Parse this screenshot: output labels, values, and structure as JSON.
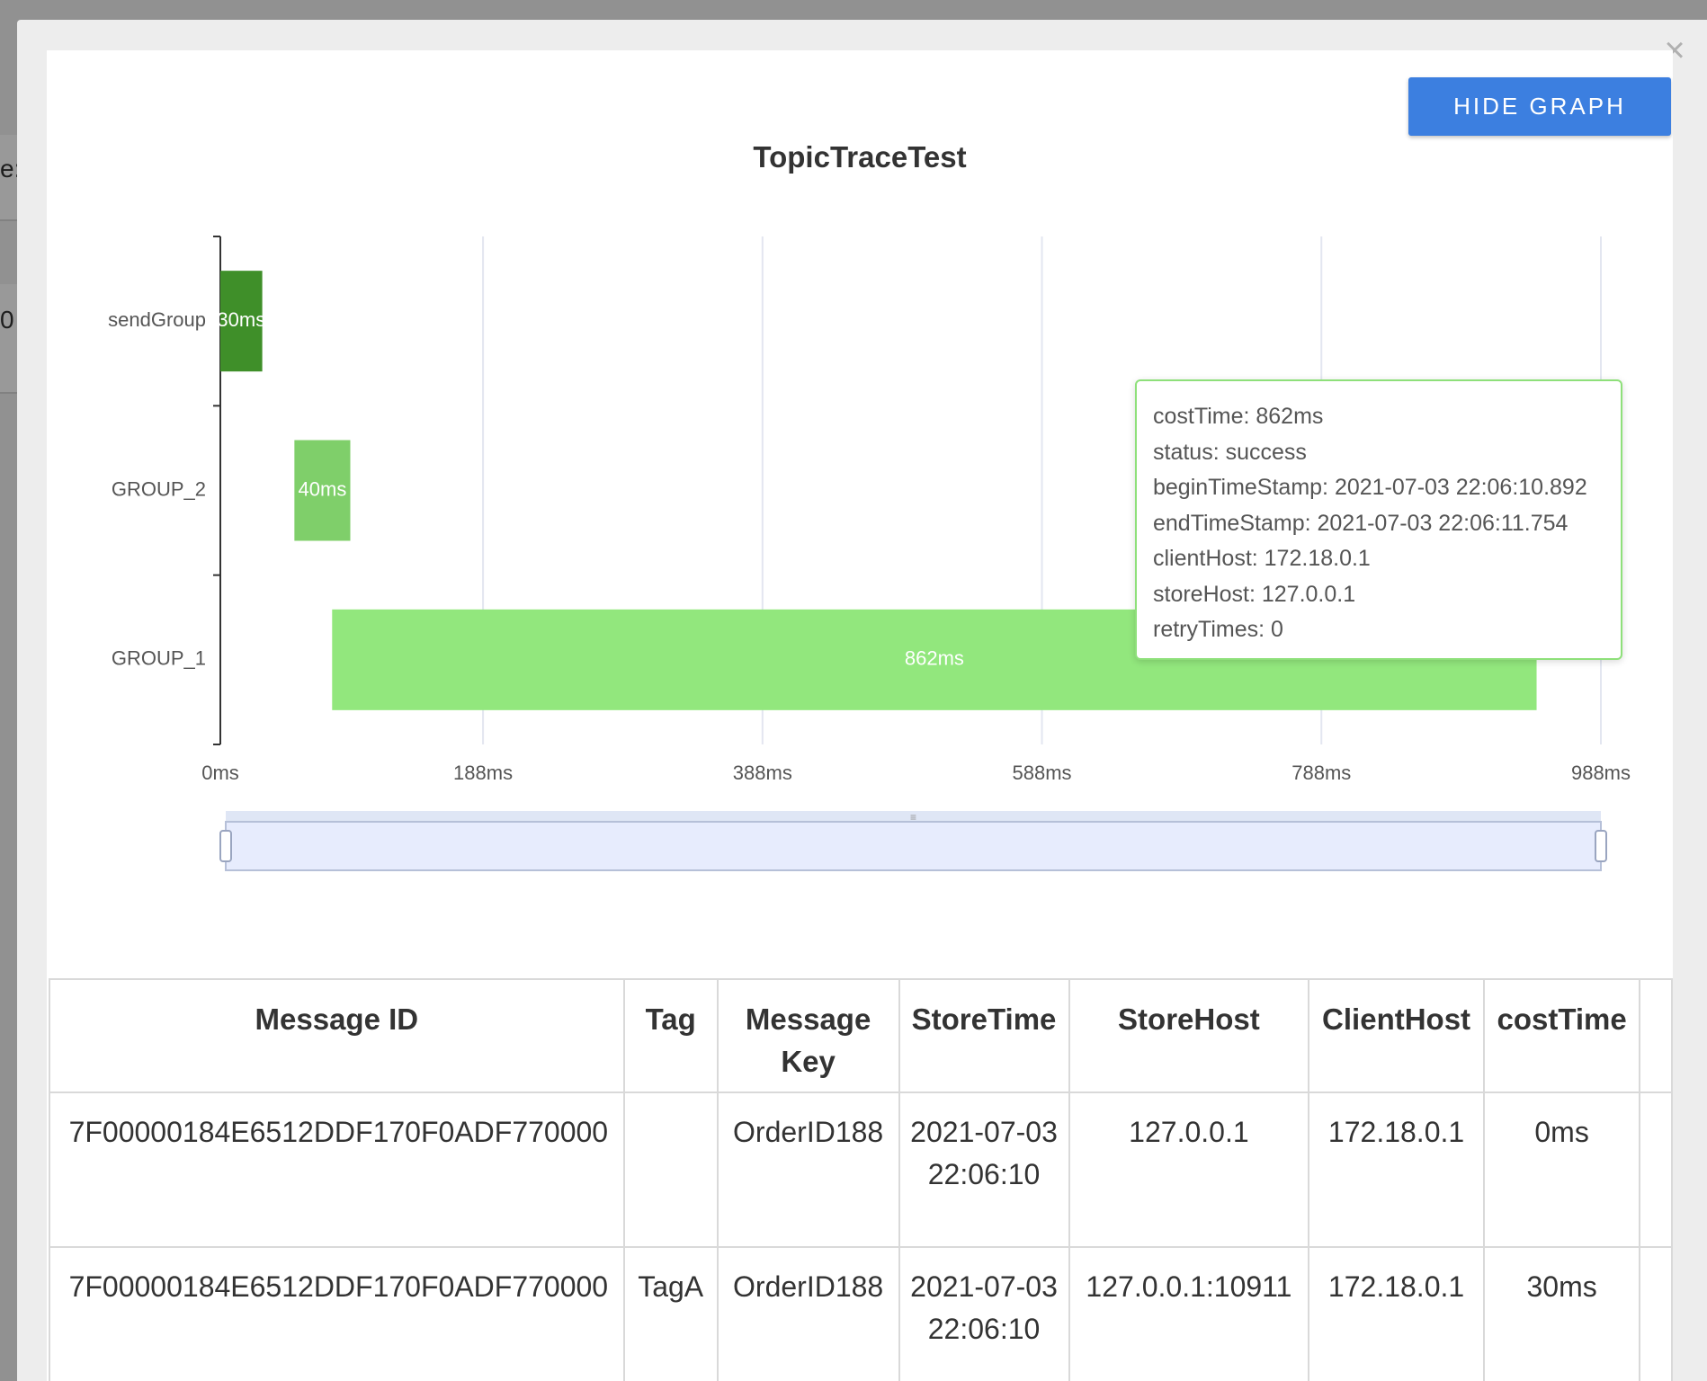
{
  "background": {
    "partial_chars": [
      "e:",
      "0"
    ]
  },
  "modal": {
    "close_icon": "×",
    "hide_graph_label": "HIDE GRAPH"
  },
  "chart_data": {
    "type": "bar",
    "orientation": "horizontal",
    "title": "TopicTraceTest",
    "categories": [
      "sendGroup",
      "GROUP_2",
      "GROUP_1"
    ],
    "x_ticks": [
      "0ms",
      "188ms",
      "388ms",
      "588ms",
      "788ms",
      "988ms"
    ],
    "x_tick_values": [
      0,
      188,
      388,
      588,
      788,
      988
    ],
    "xlim": [
      0,
      988
    ],
    "grid": true,
    "bars": [
      {
        "category": "sendGroup",
        "start": 0,
        "cost": 30,
        "label": "30ms",
        "color": "#3f8f29"
      },
      {
        "category": "GROUP_2",
        "start": 53,
        "cost": 40,
        "label": "40ms",
        "color": "#7fcf6a"
      },
      {
        "category": "GROUP_1",
        "start": 80,
        "cost": 862,
        "label": "862ms",
        "color": "#92e77d"
      }
    ],
    "data_zoom": {
      "start": 0,
      "end": 100
    }
  },
  "tooltip": {
    "lines": [
      "costTime: 862ms",
      "status: success",
      "beginTimeStamp: 2021-07-03 22:06:10.892",
      "endTimeStamp: 2021-07-03 22:06:11.754",
      "clientHost: 172.18.0.1",
      "storeHost: 127.0.0.1",
      "retryTimes: 0"
    ]
  },
  "table": {
    "headers": {
      "message_id": "Message ID",
      "tag": "Tag",
      "message_key": "Message Key",
      "store_time": "StoreTime",
      "store_host": "StoreHost",
      "client_host": "ClientHost",
      "cost_time": "costTime"
    },
    "rows": [
      {
        "message_id": "7F00000184E6512DDF170F0ADF770000",
        "tag": "",
        "message_key": "OrderID188",
        "store_time": "2021-07-03 22:06:10",
        "store_host": "127.0.0.1",
        "client_host": "172.18.0.1",
        "cost_time": "0ms"
      },
      {
        "message_id": "7F00000184E6512DDF170F0ADF770000",
        "tag": "TagA",
        "message_key": "OrderID188",
        "store_time": "2021-07-03 22:06:10",
        "store_host": "127.0.0.1:10911",
        "client_host": "172.18.0.1",
        "cost_time": "30ms"
      }
    ]
  }
}
